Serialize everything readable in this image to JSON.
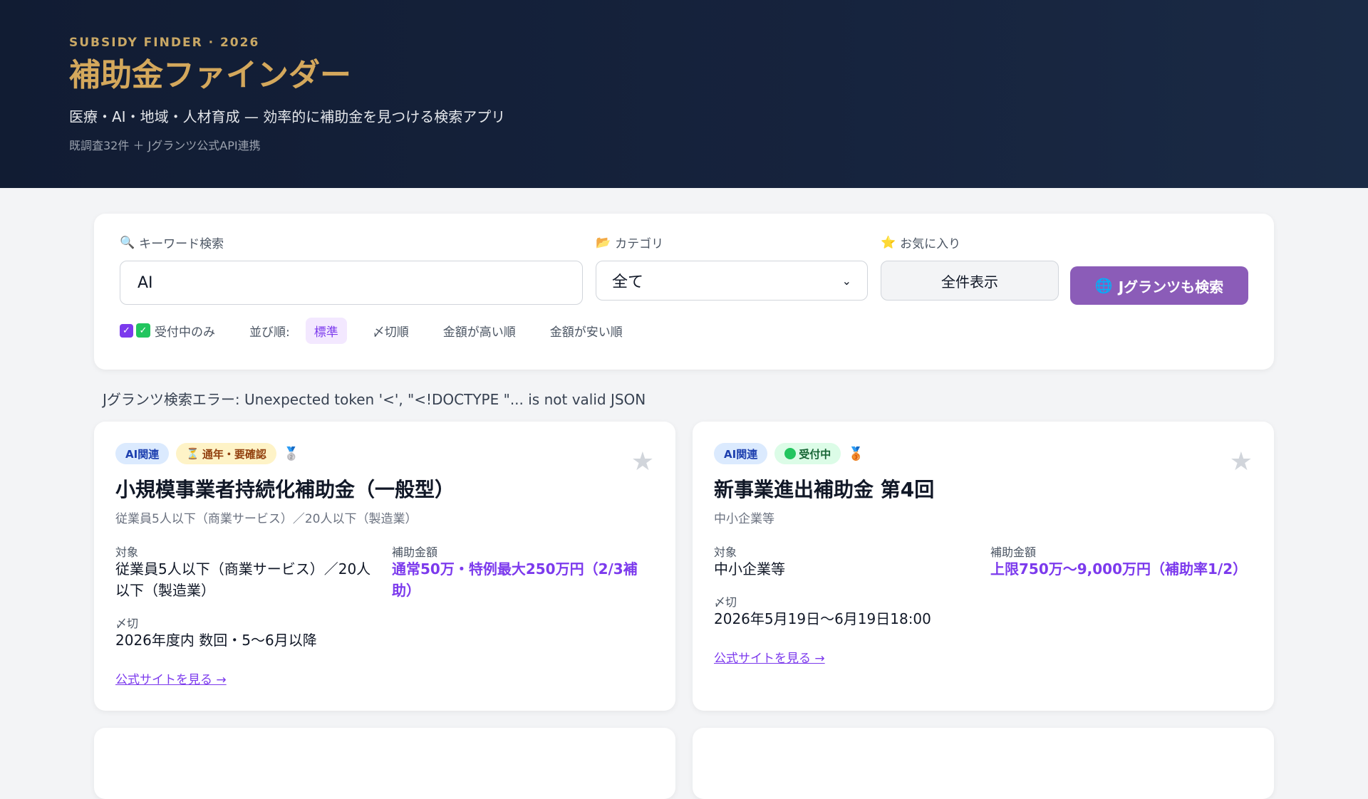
{
  "header": {
    "eyebrow": "SUBSIDY FINDER · 2026",
    "title": "補助金ファインダー",
    "subtitle": "医療・AI・地域・人材育成 — 効率的に補助金を見つける検索アプリ",
    "meta": "既調査32件 ＋ Jグランツ公式API連携"
  },
  "filters": {
    "keyword_label": "キーワード検索",
    "keyword_icon": "🔍",
    "keyword_value": "AI",
    "category_label": "カテゴリ",
    "category_icon": "📂",
    "category_value": "全て",
    "favorites_label": "お気に入り",
    "favorites_icon": "⭐",
    "show_all_label": "全件表示",
    "jgrants_label": "Jグランツも検索",
    "jgrants_icon": "🌐",
    "open_only_label": "受付中のみ",
    "sort_label": "並び順:",
    "sort_options": [
      "標準",
      "〆切順",
      "金額が高い順",
      "金額が安い順"
    ]
  },
  "error_text": "Jグランツ検索エラー: Unexpected token '<', \"<!DOCTYPE \"... is not valid JSON",
  "cards": [
    {
      "badge_category": "AI関連",
      "badge_status": "通年・要確認",
      "status_icon": "⏳",
      "medal": "🥈",
      "title": "小規模事業者持続化補助金（一般型）",
      "subtitle": "従業員5人以下（商業サービス）／20人以下（製造業）",
      "target_label": "対象",
      "target_value": "従業員5人以下（商業サービス）／20人以下（製造業）",
      "amount_label": "補助金額",
      "amount_value": "通常50万・特例最大250万円（2/3補助）",
      "deadline_label": "〆切",
      "deadline_value": "2026年度内 数回・5〜6月以降",
      "link_text": "公式サイトを見る →"
    },
    {
      "badge_category": "AI関連",
      "badge_status": "受付中",
      "medal": "🥉",
      "title": "新事業進出補助金 第4回",
      "subtitle": "中小企業等",
      "target_label": "対象",
      "target_value": "中小企業等",
      "amount_label": "補助金額",
      "amount_value": "上限750万〜9,000万円（補助率1/2）",
      "deadline_label": "〆切",
      "deadline_value": "2026年5月19日〜6月19日18:00",
      "link_text": "公式サイトを見る →"
    }
  ]
}
